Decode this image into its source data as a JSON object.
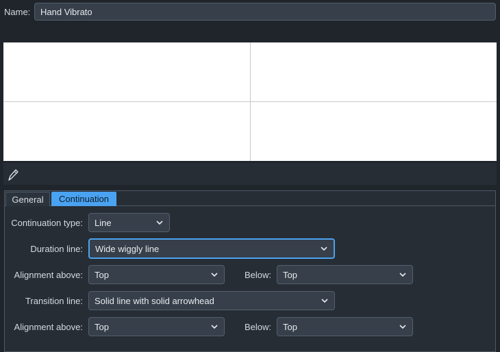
{
  "name_row": {
    "label": "Name:",
    "value": "Hand Vibrato"
  },
  "tabs": [
    {
      "label": "General",
      "active": false
    },
    {
      "label": "Continuation",
      "active": true
    }
  ],
  "form": {
    "continuation_type": {
      "label": "Continuation type:",
      "value": "Line"
    },
    "duration_line": {
      "label": "Duration line:",
      "value": "Wide wiggly line"
    },
    "alignment_above_1": {
      "label": "Alignment above:",
      "value": "Top"
    },
    "below_1": {
      "label": "Below:",
      "value": "Top"
    },
    "transition_line": {
      "label": "Transition line:",
      "value": "Solid line with solid arrowhead"
    },
    "alignment_above_2": {
      "label": "Alignment above:",
      "value": "Top"
    },
    "below_2": {
      "label": "Below:",
      "value": "Top"
    }
  },
  "icons": {
    "edit": "pencil-icon",
    "dropdown": "chevron-down-icon"
  },
  "colors": {
    "accent": "#4aa3f2",
    "background": "#1f252b",
    "field": "#363f4a"
  }
}
